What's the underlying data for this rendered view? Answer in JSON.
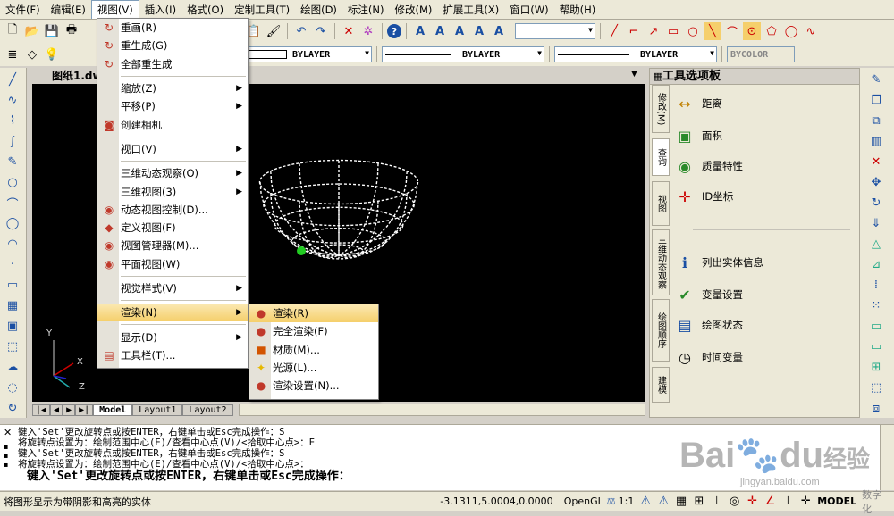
{
  "menubar": [
    "文件(F)",
    "编辑(E)",
    "视图(V)",
    "插入(I)",
    "格式(O)",
    "定制工具(T)",
    "绘图(D)",
    "标注(N)",
    "修改(M)",
    "扩展工具(X)",
    "窗口(W)",
    "帮助(H)"
  ],
  "layer_props": {
    "color": "BYLAYER",
    "linetype": "BYLAYER",
    "lineweight": "BYLAYER",
    "plotstyle": "BYCOLOR"
  },
  "doc_tab": "图纸1.dw",
  "layout_tabs": [
    "Model",
    "Layout1",
    "Layout2"
  ],
  "ucs": {
    "y": "Y",
    "x": "X",
    "z": "Z"
  },
  "palette": {
    "title": "工具选项板",
    "side_tabs": [
      "修改(M)",
      "查询",
      "视图",
      "三维动态观察",
      "绘图顺序",
      "建模"
    ],
    "tools": [
      "距离",
      "面积",
      "质量特性",
      "ID坐标",
      "列出实体信息",
      "变量设置",
      "绘图状态",
      "时间变量"
    ]
  },
  "view_menu": [
    {
      "label": "重画(R)",
      "icon": "redraw-icon",
      "glyph": "↻"
    },
    {
      "label": "重生成(G)",
      "icon": "regen-icon",
      "glyph": "↻"
    },
    {
      "label": "全部重生成",
      "icon": "regen-all-icon",
      "glyph": "↻",
      "sep_after": true
    },
    {
      "label": "缩放(Z)",
      "sub": true
    },
    {
      "label": "平移(P)",
      "sub": true
    },
    {
      "label": "创建相机",
      "icon": "camera-icon",
      "glyph": "◙",
      "sep_after": true
    },
    {
      "label": "视口(V)",
      "sub": true,
      "sep_after": true
    },
    {
      "label": "三维动态观察(O)",
      "sub": true
    },
    {
      "label": "三维视图(3)",
      "sub": true
    },
    {
      "label": "动态视图控制(D)...",
      "icon": "eye-icon",
      "glyph": "◉"
    },
    {
      "label": "定义视图(F)",
      "icon": "define-view-icon",
      "glyph": "◆"
    },
    {
      "label": "视图管理器(M)...",
      "icon": "view-manager-icon",
      "glyph": "◉"
    },
    {
      "label": "平面视图(W)",
      "icon": "plan-view-icon",
      "glyph": "◉",
      "sep_after": true
    },
    {
      "label": "视觉样式(V)",
      "sub": true,
      "sep_after": true
    },
    {
      "label": "渲染(N)",
      "sub": true,
      "highlight": true,
      "sep_after": true
    },
    {
      "label": "显示(D)",
      "sub": true
    },
    {
      "label": "工具栏(T)...",
      "icon": "toolbar-icon",
      "glyph": "▤"
    }
  ],
  "render_menu": [
    {
      "label": "渲染(R)",
      "icon": "render-icon",
      "glyph": "●",
      "color": "#c0392b",
      "highlight": true
    },
    {
      "label": "完全渲染(F)",
      "icon": "full-render-icon",
      "glyph": "●",
      "color": "#c0392b"
    },
    {
      "label": "材质(M)...",
      "icon": "material-icon",
      "glyph": "■",
      "color": "#d35400"
    },
    {
      "label": "光源(L)...",
      "icon": "light-icon",
      "glyph": "✦",
      "color": "#e6b800"
    },
    {
      "label": "渲染设置(N)...",
      "icon": "render-settings-icon",
      "glyph": "●",
      "color": "#c0392b"
    }
  ],
  "command_lines": [
    "键入'Set'更改旋转点或按ENTER，右键单击或Esc完成操作：S",
    "将旋转点设置为：绘制范围中心(E)/查看中心点(V)/<拾取中心点>：E",
    "键入'Set'更改旋转点或按ENTER，右键单击或Esc完成操作：S",
    "将旋转点设置为：绘制范围中心(E)/查看中心点(V)/<拾取中心点>："
  ],
  "command_prompt": "键入'Set'更改旋转点或按ENTER，右键单击或Esc完成操作：",
  "status": {
    "hint": "将图形显示为带阴影和高亮的实体",
    "coords": "-3.1311,5.0004,0.0000",
    "renderer": "OpenGL",
    "scale": "1:1",
    "model": "MODEL",
    "extra": "数字化"
  },
  "watermark": {
    "brand": "Bai",
    "logo": "du",
    "suffix": "经验",
    "url": "jingyan.baidu.com"
  },
  "colors": {
    "accent": "#f5cf6b",
    "canvas": "#000000",
    "wire": "#ffffff",
    "pivot": "#22cc22"
  }
}
